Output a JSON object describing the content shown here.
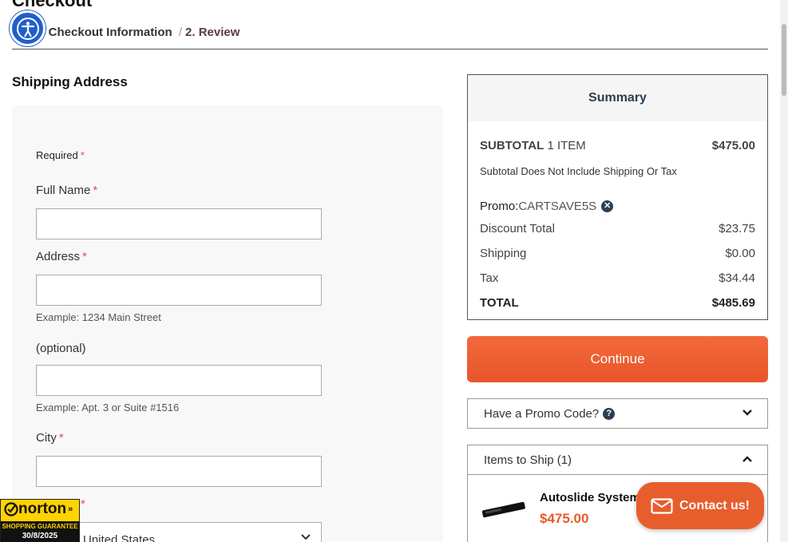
{
  "page": {
    "title": "Checkout"
  },
  "breadcrumb": {
    "step1": "1. Checkout Information",
    "separator": "/",
    "step2": "2. Review"
  },
  "shipping": {
    "title": "Shipping Address",
    "required": "Required",
    "star": "*",
    "fields": {
      "full_name": {
        "label": "Full Name",
        "value": ""
      },
      "address": {
        "label": "Address",
        "value": "",
        "hint": "Example: 1234 Main Street"
      },
      "address2": {
        "label": "(optional)",
        "value": "",
        "hint": "Example: Apt. 3 or Suite #1516"
      },
      "city": {
        "label": "City",
        "value": ""
      },
      "country": {
        "value": "United States"
      }
    }
  },
  "summary": {
    "title": "Summary",
    "subtotal_label": "SUBTOTAL",
    "subtotal_count": "1 ITEM",
    "subtotal_value": "$475.00",
    "subtotal_note": "Subtotal Does Not Include Shipping Or Tax",
    "promo_label": "Promo:",
    "promo_code": "CARTSAVE5S",
    "discount_label": "Discount Total",
    "discount_value": "$23.75",
    "shipping_label": "Shipping",
    "shipping_value": "$0.00",
    "tax_label": "Tax",
    "tax_value": "$34.44",
    "total_label": "TOTAL",
    "total_value": "$485.69"
  },
  "actions": {
    "continue_label": "Continue"
  },
  "promo_accordion": {
    "label": "Have a Promo Code?"
  },
  "items_accordion": {
    "label": "Items to Ship (1)",
    "items": [
      {
        "name": "Autoslide System",
        "price": "$475.00"
      }
    ]
  },
  "contact": {
    "label": "Contact us!"
  },
  "norton": {
    "brand": "norton",
    "guarantee": "SHOPPING GUARANTEE",
    "date": "30/8/2025"
  },
  "colors": {
    "accent": "#e85a2a",
    "a11y": "#1f5fc8",
    "norton": "#ffd200"
  }
}
